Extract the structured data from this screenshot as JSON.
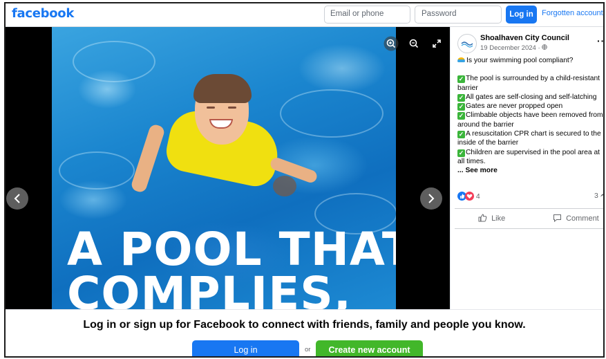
{
  "header": {
    "logo": "facebook",
    "email_placeholder": "Email or phone",
    "password_placeholder": "Password",
    "login_label": "Log in",
    "forgot_label": "Forgotten account?"
  },
  "media": {
    "overlay_text_line1": "A POOL THAT",
    "overlay_text_line2": "COMPLIES,",
    "tools": [
      "zoom-in-icon",
      "zoom-out-icon",
      "fullscreen-icon"
    ],
    "prev_icon": "chevron-left-icon",
    "next_icon": "chevron-right-icon"
  },
  "post": {
    "page_name": "Shoalhaven City Council",
    "date": "19 December 2024 · ",
    "more_label": "···",
    "intro": "Is your swimming pool compliant?",
    "checklist": [
      "The pool is surrounded by a child-resistant barrier",
      "All gates are self-closing and self-latching",
      "Gates are never propped open",
      "Climbable objects have been removed from around the barrier",
      "A resuscitation CPR chart is secured to the inside of the barrier",
      "Children are supervised in the pool area at all times."
    ],
    "see_more": "... See more",
    "reaction_count": "4",
    "shares_count": "3",
    "like_label": "Like",
    "comment_label": "Comment"
  },
  "banner": {
    "text": "Log in or sign up for Facebook to connect with friends, family and people you know.",
    "login_label": "Log in",
    "or_label": "or",
    "create_label": "Create new account"
  },
  "colors": {
    "brand_blue": "#1877f2",
    "create_green": "#42b72a"
  }
}
